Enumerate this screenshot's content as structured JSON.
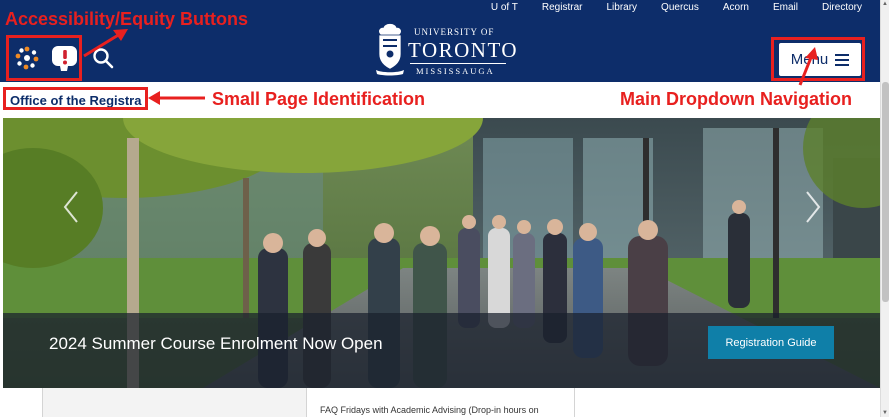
{
  "utility_nav": [
    "U of T",
    "Registrar",
    "Library",
    "Quercus",
    "Acorn",
    "Email",
    "Directory"
  ],
  "logo": {
    "line1": "UNIVERSITY OF",
    "line2": "TORONTO",
    "line3": "MISSISSAUGA"
  },
  "header": {
    "accessibility_icon": "accessibility-icon",
    "equity_icon": "equity-alert-icon",
    "search_icon": "search-icon"
  },
  "menu": {
    "label": "Menu",
    "icon": "hamburger-icon"
  },
  "page_id": {
    "label": "Office of the Registra"
  },
  "hero": {
    "caption": "2024 Summer Course Enrolment Now Open",
    "button_label": "Registration Guide",
    "prev_icon": "chevron-left-icon",
    "next_icon": "chevron-right-icon"
  },
  "cards": [
    {
      "text": ""
    },
    {
      "text": "FAQ Fridays with Academic Advising (Drop-in hours on"
    },
    {
      "text": ""
    }
  ],
  "annotations": {
    "accessibility": "Accessibility/Equity Buttons",
    "page_id": "Small Page Identification",
    "navigation": "Main Dropdown Navigation"
  },
  "colors": {
    "header_navy": "#0d2d6a",
    "button_teal": "#0f7fa8",
    "annotation_red": "#e8201f"
  }
}
